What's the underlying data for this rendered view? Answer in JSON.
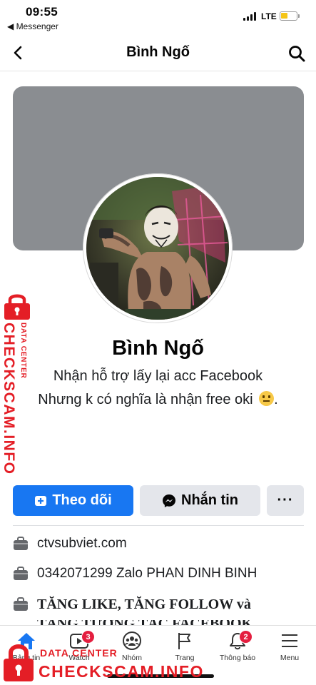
{
  "status_bar": {
    "time": "09:55",
    "back_app": "◀ Messenger",
    "network": "LTE",
    "battery_level": 0.45
  },
  "header": {
    "title": "Bình Ngố",
    "back_icon": "chevron-left-icon",
    "search_icon": "search-icon"
  },
  "profile": {
    "name": "Bình Ngố",
    "bio_line1": "Nhận hỗ trợ lấy lại acc Facebook",
    "bio_line2": "Nhưng k có nghĩa là nhận free oki",
    "bio_emoji": "neutral-face-emoji"
  },
  "actions": {
    "follow_label": "Theo dõi",
    "message_label": "Nhắn tin",
    "more_label": "···"
  },
  "intro": [
    {
      "icon": "briefcase-icon",
      "text": "ctvsubviet.com"
    },
    {
      "icon": "briefcase-icon",
      "text": "0342071299 Zalo PHAN DINH BINH"
    },
    {
      "icon": "briefcase-icon",
      "text": "TĂNG LIKE, TĂNG FOLLOW và"
    },
    {
      "icon": "",
      "text": "TĂNG TƯƠNG TÁC FACEBOOK"
    }
  ],
  "tabbar": {
    "tabs": [
      {
        "label": "Bảng tin",
        "icon": "home-icon",
        "badge": ""
      },
      {
        "label": "Watch",
        "icon": "watch-icon",
        "badge": "3"
      },
      {
        "label": "Nhóm",
        "icon": "groups-icon",
        "badge": ""
      },
      {
        "label": "Trang",
        "icon": "flag-icon",
        "badge": ""
      },
      {
        "label": "Thông báo",
        "icon": "bell-icon",
        "badge": "2"
      },
      {
        "label": "Menu",
        "icon": "menu-icon",
        "badge": ""
      }
    ]
  },
  "watermark": {
    "brand": "CHECKSCAM.INFO",
    "sub": "DATA CENTER"
  },
  "colors": {
    "accent": "#1877f2",
    "cover": "#8a8d91",
    "badge": "#e41e3f",
    "watermark": "#e41e26"
  }
}
